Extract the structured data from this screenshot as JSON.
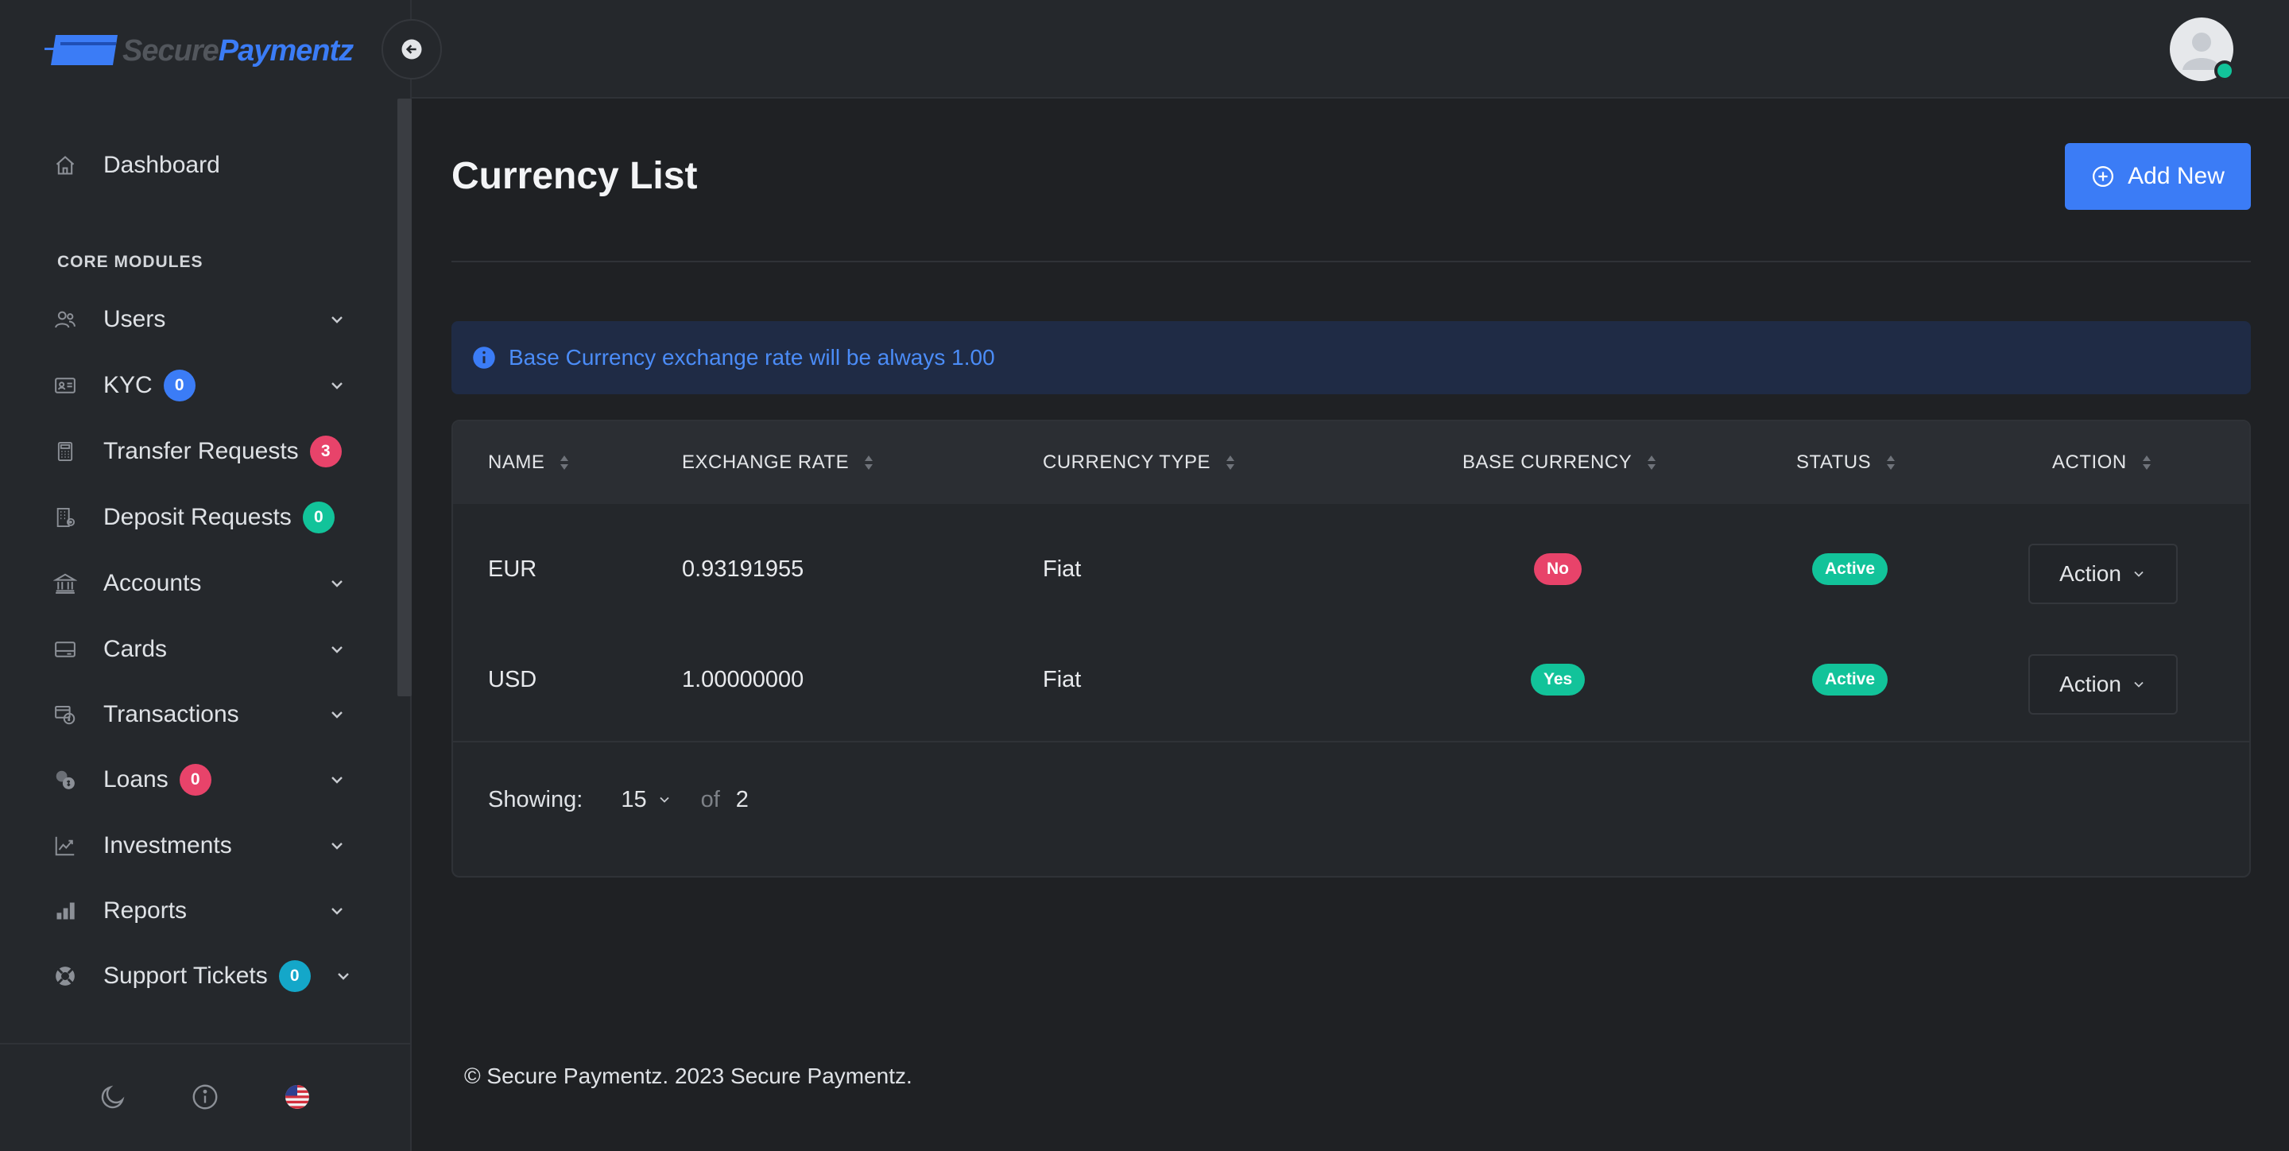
{
  "brand": {
    "part1": "Secure",
    "part2": "Paymentz",
    "colors": {
      "muted": "#52565c",
      "accent": "#3b7cf6"
    }
  },
  "header": {
    "collapse_icon": "arrow-left-circle-icon",
    "avatar_icon": "user-avatar-icon",
    "online_status_color": "#12c39a"
  },
  "sidebar": {
    "dashboard": {
      "label": "Dashboard",
      "icon": "home-icon"
    },
    "section_title": "CORE MODULES",
    "items": [
      {
        "label": "Users",
        "icon": "users-icon",
        "badge": null,
        "chevron": true
      },
      {
        "label": "KYC",
        "icon": "id-card-icon",
        "badge": "0",
        "badge_color": "#3b7cf6",
        "chevron": true
      },
      {
        "label": "Transfer Requests",
        "icon": "calculator-icon",
        "badge": "3",
        "badge_color": "#e8436a",
        "chevron": false
      },
      {
        "label": "Deposit Requests",
        "icon": "building-icon",
        "badge": "0",
        "badge_color": "#12c39a",
        "chevron": false
      },
      {
        "label": "Accounts",
        "icon": "bank-icon",
        "badge": null,
        "chevron": true
      },
      {
        "label": "Cards",
        "icon": "credit-card-icon",
        "badge": null,
        "chevron": true
      },
      {
        "label": "Transactions",
        "icon": "transactions-icon",
        "badge": null,
        "chevron": true
      },
      {
        "label": "Loans",
        "icon": "coins-icon",
        "badge": "0",
        "badge_color": "#e8436a",
        "chevron": true
      },
      {
        "label": "Investments",
        "icon": "chart-line-icon",
        "badge": null,
        "chevron": true
      },
      {
        "label": "Reports",
        "icon": "bar-chart-icon",
        "badge": null,
        "chevron": true
      },
      {
        "label": "Support Tickets",
        "icon": "life-ring-icon",
        "badge": "0",
        "badge_color": "#14a7c9",
        "chevron": true
      }
    ],
    "footer_icons": [
      "moon-icon",
      "info-icon",
      "us-flag-icon"
    ]
  },
  "main": {
    "title": "Currency List",
    "add_button": "Add New",
    "alert": "Base Currency exchange rate will be always 1.00",
    "table": {
      "columns": [
        "NAME",
        "EXCHANGE RATE",
        "CURRENCY TYPE",
        "BASE CURRENCY",
        "STATUS",
        "ACTION"
      ],
      "rows": [
        {
          "name": "EUR",
          "rate": "0.93191955",
          "type": "Fiat",
          "base": "No",
          "base_color": "#e8436a",
          "status": "Active",
          "status_color": "#12c39a",
          "action": "Action"
        },
        {
          "name": "USD",
          "rate": "1.00000000",
          "type": "Fiat",
          "base": "Yes",
          "base_color": "#12c39a",
          "status": "Active",
          "status_color": "#12c39a",
          "action": "Action"
        }
      ]
    },
    "pagination": {
      "label": "Showing:",
      "per_page": "15",
      "of": "of",
      "total": "2"
    }
  },
  "footer": {
    "text": "© Secure Paymentz. 2023 Secure Paymentz."
  }
}
